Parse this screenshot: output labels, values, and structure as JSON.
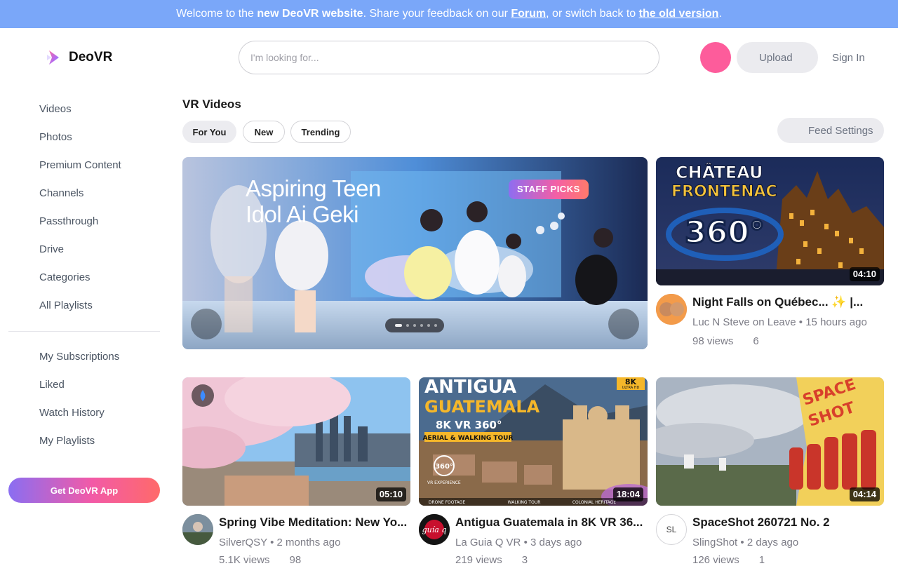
{
  "banner": {
    "prefix": "Welcome to the",
    "new_site": "new DeoVR website",
    "middle": ". Share your feedback on our",
    "forum": "Forum",
    "middle2": ", or switch back to",
    "old_version": "the old version",
    "suffix": "."
  },
  "header": {
    "logo_text": "DeoVR",
    "search_placeholder": "I'm looking for...",
    "upload": "Upload",
    "sign_in": "Sign In"
  },
  "sidebar": {
    "main": [
      "Videos",
      "Photos",
      "Premium Content",
      "Channels",
      "Passthrough",
      "Drive",
      "Categories",
      "All Playlists"
    ],
    "library": [
      "My Subscriptions",
      "Liked",
      "Watch History",
      "My Playlists"
    ],
    "get_app": "Get DeoVR App"
  },
  "feed": {
    "title": "VR Videos",
    "tabs": [
      "For You",
      "New",
      "Trending"
    ],
    "active_tab": "For You",
    "feed_settings": "Feed Settings"
  },
  "hero": {
    "title_line1": "Aspiring Teen",
    "title_line2": "Idol Ai Geki",
    "badge": "STAFF PICKS",
    "slide_count": 6
  },
  "videos": [
    {
      "id": "v1",
      "thumb_text_1": "CHÂTEAU",
      "thumb_text_2": "FRONTENAC",
      "thumb_text_3": "360°",
      "duration": "04:10",
      "title": "Night Falls on Québec... ✨ |...",
      "channel": "Luc N Steve on Leave",
      "age": "15 hours ago",
      "views": "98 views",
      "likes": "6"
    },
    {
      "id": "v2",
      "duration": "05:10",
      "title": "Spring Vibe Meditation: New Yo...",
      "channel": "SilverQSY",
      "age": "2 months ago",
      "views": "5.1K views",
      "likes": "98"
    },
    {
      "id": "v3",
      "thumb_text_1": "ANTIGUA",
      "thumb_text_2": "GUATEMALA",
      "thumb_text_3": "8K VR 360°",
      "thumb_text_4": "AERIAL & WALKING TOUR",
      "thumb_badge": "8K",
      "thumb_badge_sub": "ULTRA HD",
      "thumb_footer": [
        "DRONE FOOTAGE",
        "WALKING TOUR",
        "COLONIAL HERITAGE"
      ],
      "thumb_360_caption": "VR EXPERIENCE",
      "duration": "18:04",
      "title": "Antigua Guatemala in 8K VR 36...",
      "channel": "La Guia Q VR",
      "channel_logo_text": "guía q",
      "age": "3 days ago",
      "views": "219 views",
      "likes": "3"
    },
    {
      "id": "v4",
      "thumb_text_1": "SPACE",
      "thumb_text_2": "SHOT",
      "duration": "04:14",
      "title": "SpaceShot 260721 No. 2",
      "channel": "SlingShot",
      "channel_initials": "SL",
      "age": "2 days ago",
      "views": "126 views",
      "likes": "1"
    }
  ],
  "meta_separator": "•",
  "colors": {
    "banner_bg": "#7aa7f9",
    "brand_pink": "#fd5c9b",
    "text_muted": "#7c7c86"
  }
}
